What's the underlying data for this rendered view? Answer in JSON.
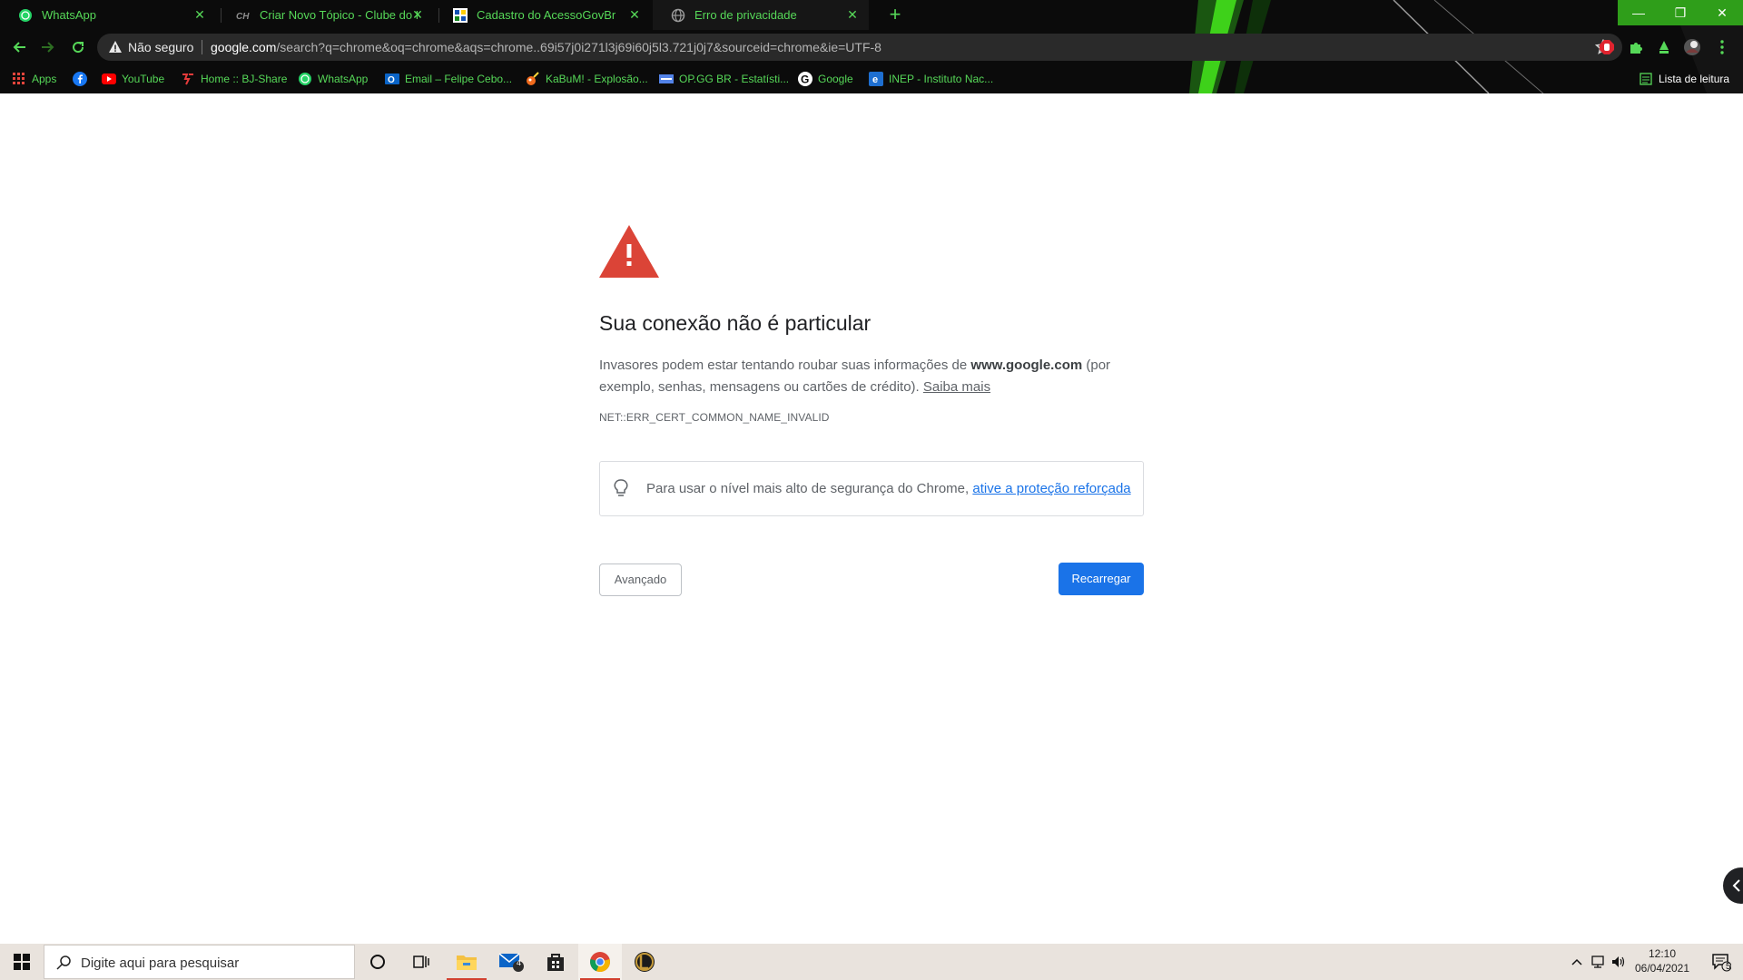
{
  "browser": {
    "tabs": [
      {
        "title": "WhatsApp",
        "icon": "whatsapp-icon"
      },
      {
        "title": "Criar Novo Tópico - Clube do Ha",
        "icon": "clube-hardware-icon"
      },
      {
        "title": "Cadastro do AcessoGovBr",
        "icon": "govbr-icon"
      },
      {
        "title": "Erro de privacidade",
        "icon": "globe-icon"
      }
    ],
    "active_tab_index": 3,
    "omnibox": {
      "security_label": "Não seguro",
      "url_host": "google.com",
      "url_rest": "/search?q=chrome&oq=chrome&aqs=chrome..69i57j0i271l3j69i60j5l3.721j0j7&sourceid=chrome&ie=UTF-8"
    },
    "bookmarks": [
      {
        "label": "Apps",
        "icon": "apps-grid-icon"
      },
      {
        "label": "",
        "icon": "facebook-icon"
      },
      {
        "label": "YouTube",
        "icon": "youtube-icon"
      },
      {
        "label": "Home :: BJ-Share",
        "icon": "bjshare-icon"
      },
      {
        "label": "WhatsApp",
        "icon": "whatsapp-icon"
      },
      {
        "label": "Email – Felipe Cebo...",
        "icon": "outlook-icon"
      },
      {
        "label": "KaBuM! - Explosão...",
        "icon": "kabum-icon"
      },
      {
        "label": "OP.GG BR - Estatísti...",
        "icon": "opgg-icon"
      },
      {
        "label": "Google",
        "icon": "google-icon"
      },
      {
        "label": "INEP - Instituto Nac...",
        "icon": "inep-icon"
      }
    ],
    "reading_list_label": "Lista de leitura",
    "theme_colors": {
      "accent": "#56d858",
      "frame": "#0b0b0b",
      "window_buttons": "#2f9e1a"
    }
  },
  "page": {
    "heading": "Sua conexão não é particular",
    "explanation_prefix": "Invasores podem estar tentando roubar suas informações de ",
    "explanation_host": "www.google.com",
    "explanation_suffix": " (por exemplo, senhas, mensagens ou cartões de crédito). ",
    "learn_more": "Saiba mais",
    "error_code": "NET::ERR_CERT_COMMON_NAME_INVALID",
    "enhanced_text": "Para usar o nível mais alto de segurança do Chrome, ",
    "enhanced_link": "ative a proteção reforçada",
    "advanced_label": "Avançado",
    "reload_label": "Recarregar",
    "colors": {
      "warning": "#db4437",
      "primary": "#1a73e8"
    }
  },
  "taskbar": {
    "search_placeholder": "Digite aqui para pesquisar",
    "mail_badge": "4",
    "clock_time": "12:10",
    "clock_date": "06/04/2021",
    "notification_count": "5"
  }
}
